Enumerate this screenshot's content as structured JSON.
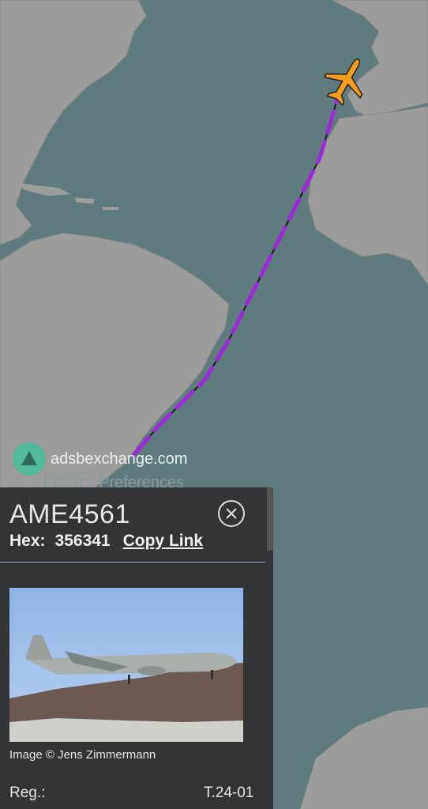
{
  "map": {
    "attribution": "adsbexchange.com",
    "privacy_link": "Privacy Preferences",
    "colors": {
      "ocean": "#5f7b7d",
      "land": "#9c9c9a",
      "track": "#9b2bd9",
      "aircraft": "#f39c1e"
    }
  },
  "aircraft": {
    "callsign": "AME4561",
    "hex_label": "Hex:",
    "hex_value": "356341",
    "copy_link_label": "Copy Link",
    "photo_caption": "Image © Jens Zimmermann",
    "reg_label": "Reg.:",
    "reg_value": "T.24-01"
  }
}
